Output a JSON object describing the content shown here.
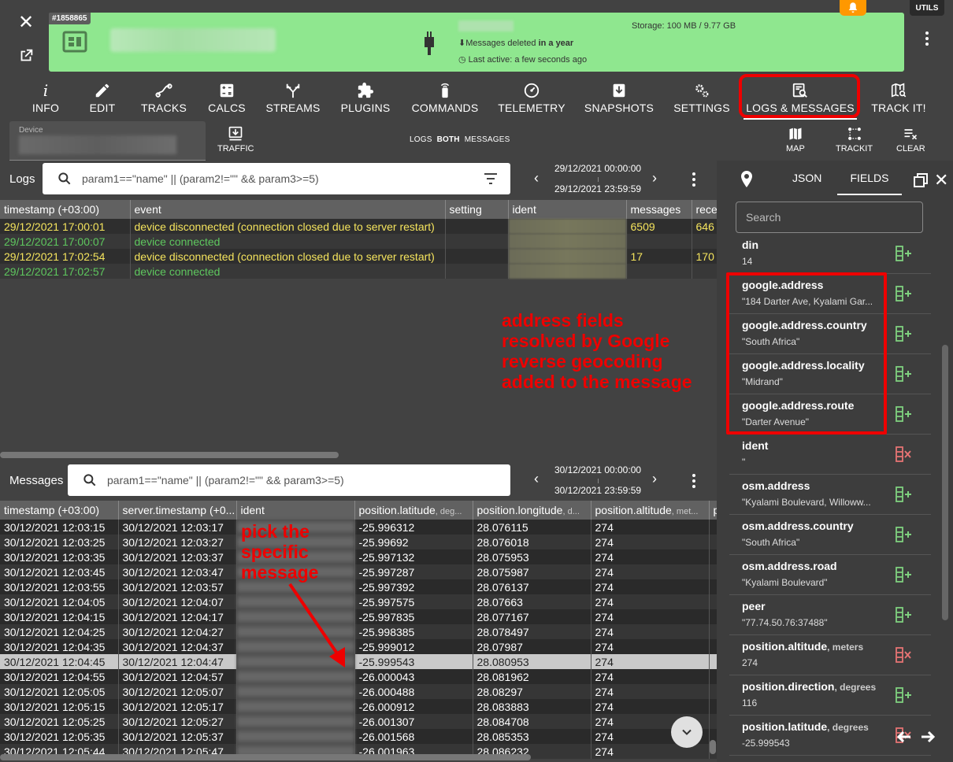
{
  "header": {
    "device_id": "#1858865",
    "messages_deleted_prefix": "Messages deleted ",
    "messages_deleted_bold": "in a year",
    "last_active": "Last active: a few seconds ago",
    "storage": "Storage: 100 MB / 9.77 GB",
    "utils": "UTILS",
    "card_color": "#8fe78f"
  },
  "tabs": [
    {
      "label": "INFO"
    },
    {
      "label": "EDIT"
    },
    {
      "label": "TRACKS"
    },
    {
      "label": "CALCS"
    },
    {
      "label": "STREAMS"
    },
    {
      "label": "PLUGINS"
    },
    {
      "label": "COMMANDS"
    },
    {
      "label": "TELEMETRY"
    },
    {
      "label": "SNAPSHOTS"
    },
    {
      "label": "SETTINGS"
    },
    {
      "label": "LOGS & MESSAGES"
    },
    {
      "label": "TRACK IT!"
    }
  ],
  "toolbar": {
    "device_label": "Device",
    "traffic": "TRAFFIC",
    "mode_logs": "LOGS",
    "mode_both": "BOTH",
    "mode_messages": "MESSAGES",
    "map": "MAP",
    "trackit": "TRACKIT",
    "clear": "CLEAR"
  },
  "logs": {
    "label": "Logs",
    "filter": "param1==\"name\" || (param2!=\"\" && param3>=5)",
    "range_from": "29/12/2021 00:00:00",
    "range_to": "29/12/2021 23:59:59",
    "columns": [
      "timestamp (+03:00)",
      "event",
      "setting",
      "ident",
      "messages",
      "rece"
    ],
    "rows": [
      {
        "ts": "29/12/2021 17:00:01",
        "event": "device disconnected (connection closed due to server restart)",
        "messages": "6509",
        "recv": "646",
        "color": "yellow"
      },
      {
        "ts": "29/12/2021 17:00:07",
        "event": "device connected",
        "messages": "",
        "recv": "",
        "color": "green"
      },
      {
        "ts": "29/12/2021 17:02:54",
        "event": "device disconnected (connection closed due to server restart)",
        "messages": "17",
        "recv": "170",
        "color": "yellow"
      },
      {
        "ts": "29/12/2021 17:02:57",
        "event": "device connected",
        "messages": "",
        "recv": "",
        "color": "green"
      }
    ]
  },
  "annotations": {
    "address_note": [
      "address fields",
      "resolved by Google",
      "reverse geocoding",
      "added to the message"
    ],
    "pick_note": [
      "pick the",
      "specific",
      "message"
    ]
  },
  "messages": {
    "label": "Messages",
    "filter": "param1==\"name\" || (param2!=\"\" && param3>=5)",
    "range_from": "30/12/2021 00:00:00",
    "range_to": "30/12/2021 23:59:59",
    "columns": [
      {
        "name": "timestamp (+03:00)",
        "unit": ""
      },
      {
        "name": "server.timestamp (+0...",
        "unit": ""
      },
      {
        "name": "ident",
        "unit": ""
      },
      {
        "name": "position.latitude",
        "unit": ", deg..."
      },
      {
        "name": "position.longitude",
        "unit": ", d..."
      },
      {
        "name": "position.altitude",
        "unit": ", met..."
      },
      {
        "name": "p",
        "unit": ""
      }
    ],
    "rows": [
      {
        "ts": "30/12/2021 12:03:15",
        "sts": "30/12/2021 12:03:17",
        "lat": "-25.996312",
        "lon": "28.076115",
        "alt": "274"
      },
      {
        "ts": "30/12/2021 12:03:25",
        "sts": "30/12/2021 12:03:27",
        "lat": "-25.99692",
        "lon": "28.076018",
        "alt": "274"
      },
      {
        "ts": "30/12/2021 12:03:35",
        "sts": "30/12/2021 12:03:37",
        "lat": "-25.997132",
        "lon": "28.075953",
        "alt": "274"
      },
      {
        "ts": "30/12/2021 12:03:45",
        "sts": "30/12/2021 12:03:47",
        "lat": "-25.997287",
        "lon": "28.075987",
        "alt": "274"
      },
      {
        "ts": "30/12/2021 12:03:55",
        "sts": "30/12/2021 12:03:57",
        "lat": "-25.997392",
        "lon": "28.076137",
        "alt": "274"
      },
      {
        "ts": "30/12/2021 12:04:05",
        "sts": "30/12/2021 12:04:07",
        "lat": "-25.997575",
        "lon": "28.07663",
        "alt": "274"
      },
      {
        "ts": "30/12/2021 12:04:15",
        "sts": "30/12/2021 12:04:17",
        "lat": "-25.997835",
        "lon": "28.077167",
        "alt": "274"
      },
      {
        "ts": "30/12/2021 12:04:25",
        "sts": "30/12/2021 12:04:27",
        "lat": "-25.998385",
        "lon": "28.078497",
        "alt": "274"
      },
      {
        "ts": "30/12/2021 12:04:35",
        "sts": "30/12/2021 12:04:37",
        "lat": "-25.999012",
        "lon": "28.07987",
        "alt": "274"
      },
      {
        "ts": "30/12/2021 12:04:45",
        "sts": "30/12/2021 12:04:47",
        "lat": "-25.999543",
        "lon": "28.080953",
        "alt": "274",
        "selected": true
      },
      {
        "ts": "30/12/2021 12:04:55",
        "sts": "30/12/2021 12:04:57",
        "lat": "-26.000043",
        "lon": "28.081962",
        "alt": "274"
      },
      {
        "ts": "30/12/2021 12:05:05",
        "sts": "30/12/2021 12:05:07",
        "lat": "-26.000488",
        "lon": "28.08297",
        "alt": "274"
      },
      {
        "ts": "30/12/2021 12:05:15",
        "sts": "30/12/2021 12:05:17",
        "lat": "-26.000912",
        "lon": "28.083883",
        "alt": "274"
      },
      {
        "ts": "30/12/2021 12:05:25",
        "sts": "30/12/2021 12:05:27",
        "lat": "-26.001307",
        "lon": "28.084708",
        "alt": "274"
      },
      {
        "ts": "30/12/2021 12:05:35",
        "sts": "30/12/2021 12:05:37",
        "lat": "-26.001568",
        "lon": "28.085353",
        "alt": "274"
      },
      {
        "ts": "30/12/2021 12:05:44",
        "sts": "30/12/2021 12:05:47",
        "lat": "-26.001963",
        "lon": "28.086232",
        "alt": "274"
      }
    ]
  },
  "fields_panel": {
    "tab_json": "JSON",
    "tab_fields": "FIELDS",
    "search_placeholder": "Search",
    "items": [
      {
        "name": "din",
        "unit": "",
        "value": "14",
        "action": "add"
      },
      {
        "name": "google.address",
        "unit": "",
        "value": "\"184 Darter Ave, Kyalami Gar...",
        "action": "add"
      },
      {
        "name": "google.address.country",
        "unit": "",
        "value": "\"South Africa\"",
        "action": "add"
      },
      {
        "name": "google.address.locality",
        "unit": "",
        "value": "\"Midrand\"",
        "action": "add"
      },
      {
        "name": "google.address.route",
        "unit": "",
        "value": "\"Darter Avenue\"",
        "action": "add"
      },
      {
        "name": "ident",
        "unit": "",
        "value": "\"",
        "action": "remove"
      },
      {
        "name": "osm.address",
        "unit": "",
        "value": "\"Kyalami Boulevard, Willoww...",
        "action": "add"
      },
      {
        "name": "osm.address.country",
        "unit": "",
        "value": "\"South Africa\"",
        "action": "add"
      },
      {
        "name": "osm.address.road",
        "unit": "",
        "value": "\"Kyalami Boulevard\"",
        "action": "add"
      },
      {
        "name": "peer",
        "unit": "",
        "value": "\"77.74.50.76:37488\"",
        "action": "add"
      },
      {
        "name": "position.altitude",
        "unit": ", meters",
        "value": "274",
        "action": "remove"
      },
      {
        "name": "position.direction",
        "unit": ", degrees",
        "value": "116",
        "action": "add"
      },
      {
        "name": "position.latitude",
        "unit": ", degrees",
        "value": "-25.999543",
        "action": "remove"
      }
    ]
  }
}
